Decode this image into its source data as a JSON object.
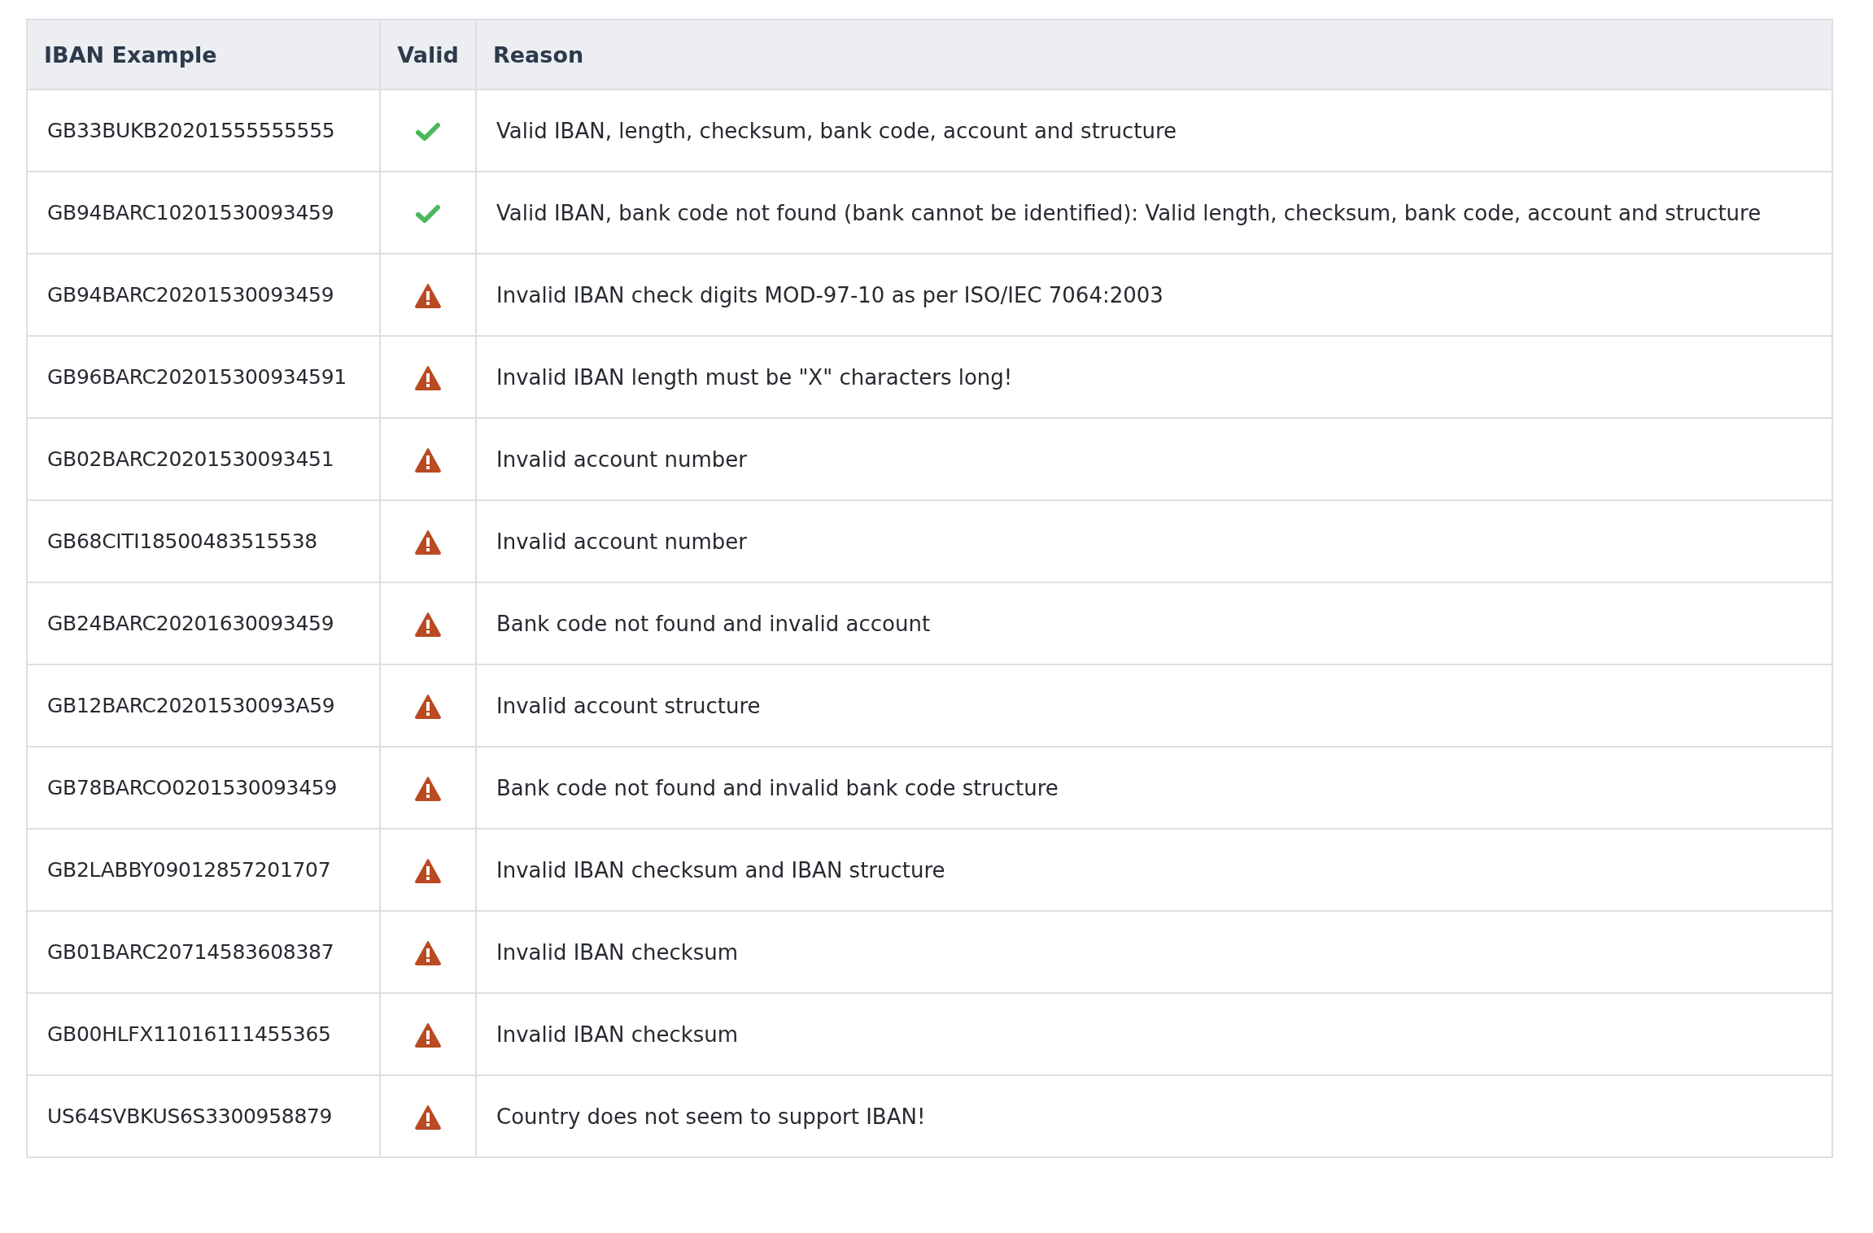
{
  "table": {
    "columns": [
      "IBAN Example",
      "Valid",
      "Reason"
    ],
    "rows": [
      {
        "iban": "GB33BUKB20201555555555",
        "valid": true,
        "reason": "Valid IBAN, length, checksum, bank code, account and structure"
      },
      {
        "iban": "GB94BARC10201530093459",
        "valid": true,
        "reason": "Valid IBAN, bank code not found (bank cannot be identified): Valid length, checksum, bank code, account and structure"
      },
      {
        "iban": "GB94BARC20201530093459",
        "valid": false,
        "reason": "Invalid IBAN check digits MOD-97-10 as per ISO/IEC 7064:2003"
      },
      {
        "iban": "GB96BARC202015300934591",
        "valid": false,
        "reason": "Invalid IBAN length must be \"X\" characters long!"
      },
      {
        "iban": "GB02BARC20201530093451",
        "valid": false,
        "reason": "Invalid account number"
      },
      {
        "iban": "GB68CITI18500483515538",
        "valid": false,
        "reason": "Invalid account number"
      },
      {
        "iban": "GB24BARC20201630093459",
        "valid": false,
        "reason": "Bank code not found and invalid account"
      },
      {
        "iban": "GB12BARC20201530093A59",
        "valid": false,
        "reason": "Invalid account structure"
      },
      {
        "iban": "GB78BARCO0201530093459",
        "valid": false,
        "reason": "Bank code not found and invalid bank code structure"
      },
      {
        "iban": "GB2LABBY09012857201707",
        "valid": false,
        "reason": "Invalid IBAN checksum and IBAN structure"
      },
      {
        "iban": "GB01BARC20714583608387",
        "valid": false,
        "reason": "Invalid IBAN checksum"
      },
      {
        "iban": "GB00HLFX11016111455365",
        "valid": false,
        "reason": "Invalid IBAN checksum"
      },
      {
        "iban": "US64SVBKUS6S3300958879",
        "valid": false,
        "reason": "Country does not seem to support IBAN!"
      }
    ]
  }
}
